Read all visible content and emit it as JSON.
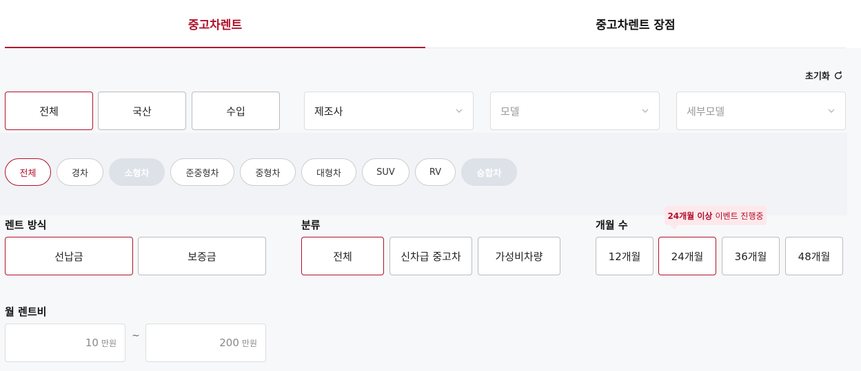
{
  "tabs": [
    {
      "label": "중고차렌트"
    },
    {
      "label": "중고차렌트 장점"
    }
  ],
  "reset": {
    "label": "초기화",
    "icon": "refresh-icon"
  },
  "origin": [
    "전체",
    "국산",
    "수입"
  ],
  "selects": {
    "maker": "제조사",
    "model": "모델",
    "detail_model": "세부모델"
  },
  "car_types": [
    "전체",
    "경차",
    "소형차",
    "준중형차",
    "중형차",
    "대형차",
    "SUV",
    "RV",
    "승합차"
  ],
  "rent_method": {
    "label": "렌트 방식",
    "options": [
      "선납금",
      "보증금"
    ]
  },
  "category": {
    "label": "분류",
    "options": [
      "전체",
      "신차급 중고차",
      "가성비차량"
    ]
  },
  "months": {
    "label": "개월 수",
    "tooltip_bold": "24개월 이상",
    "tooltip_rest": "이벤트 진행중",
    "options": [
      "12개월",
      "24개월",
      "36개월",
      "48개월"
    ]
  },
  "monthly_fee": {
    "label": "월 렌트비",
    "min": "10",
    "max": "200",
    "unit": "만원",
    "separator": "~"
  },
  "colors": {
    "accent": "#b0102a",
    "disabled_chip": "#dde1e8"
  }
}
